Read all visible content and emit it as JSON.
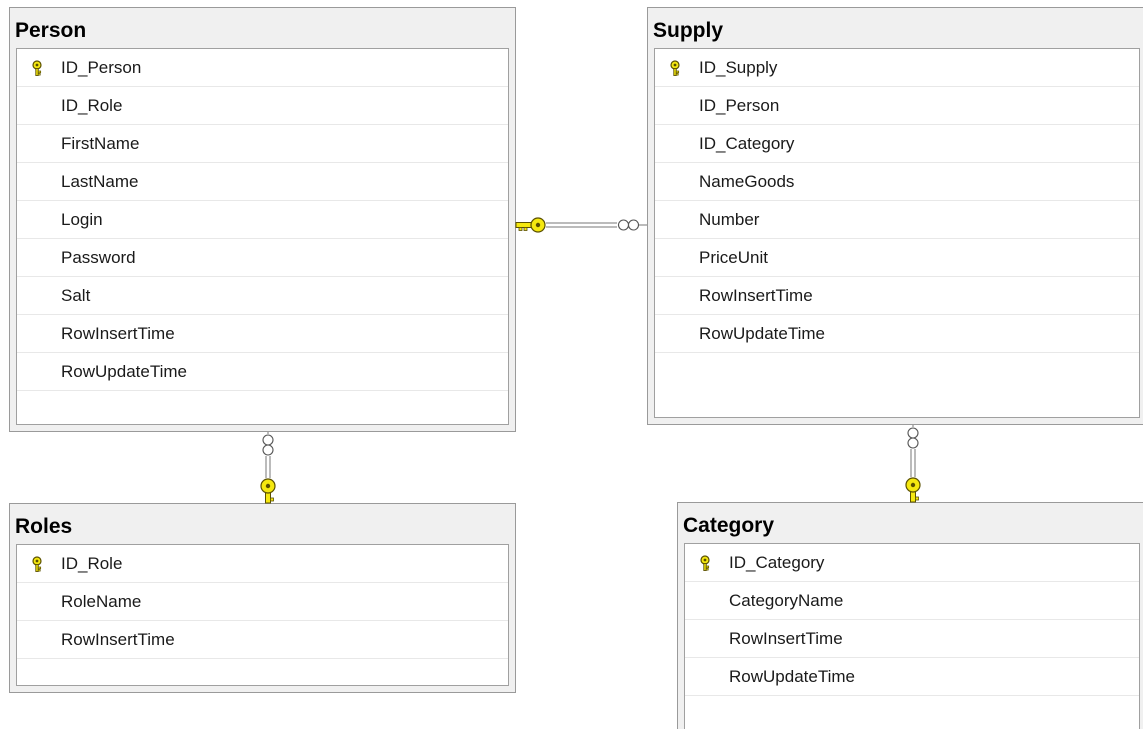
{
  "icons": {
    "primary_key": "key-icon",
    "relationship_one": "yellow-key-icon",
    "relationship_many": "infinity-icon"
  },
  "colors": {
    "key_yellow": "#f5e80f",
    "key_outline": "#5a5000",
    "line": "#777777"
  },
  "tables": {
    "person": {
      "title": "Person",
      "columns": [
        {
          "name": "ID_Person",
          "pk": true
        },
        {
          "name": "ID_Role",
          "pk": false
        },
        {
          "name": "FirstName",
          "pk": false
        },
        {
          "name": "LastName",
          "pk": false
        },
        {
          "name": "Login",
          "pk": false
        },
        {
          "name": "Password",
          "pk": false
        },
        {
          "name": "Salt",
          "pk": false
        },
        {
          "name": "RowInsertTime",
          "pk": false
        },
        {
          "name": "RowUpdateTime",
          "pk": false
        }
      ]
    },
    "supply": {
      "title": "Supply",
      "columns": [
        {
          "name": "ID_Supply",
          "pk": true
        },
        {
          "name": "ID_Person",
          "pk": false
        },
        {
          "name": "ID_Category",
          "pk": false
        },
        {
          "name": "NameGoods",
          "pk": false
        },
        {
          "name": "Number",
          "pk": false
        },
        {
          "name": "PriceUnit",
          "pk": false
        },
        {
          "name": "RowInsertTime",
          "pk": false
        },
        {
          "name": "RowUpdateTime",
          "pk": false
        }
      ]
    },
    "roles": {
      "title": "Roles",
      "columns": [
        {
          "name": "ID_Role",
          "pk": true
        },
        {
          "name": "RoleName",
          "pk": false
        },
        {
          "name": "RowInsertTime",
          "pk": false
        }
      ]
    },
    "category": {
      "title": "Category",
      "columns": [
        {
          "name": "ID_Category",
          "pk": true
        },
        {
          "name": "CategoryName",
          "pk": false
        },
        {
          "name": "RowInsertTime",
          "pk": false
        },
        {
          "name": "RowUpdateTime",
          "pk": false
        }
      ]
    }
  },
  "relationships": [
    {
      "one": "person",
      "many": "supply"
    },
    {
      "one": "roles",
      "many": "person"
    },
    {
      "one": "category",
      "many": "supply"
    }
  ]
}
